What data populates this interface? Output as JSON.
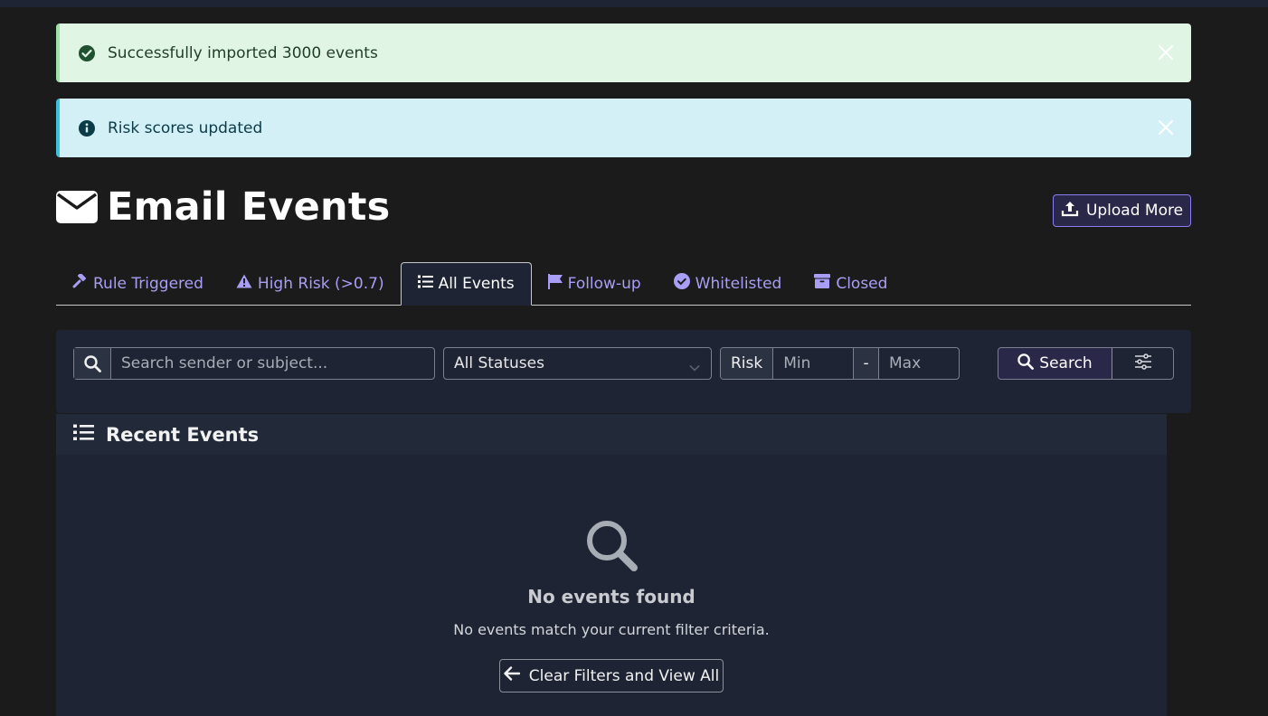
{
  "alerts": {
    "success": {
      "message": "Successfully imported 3000 events",
      "icon": "check-circle-icon"
    },
    "info": {
      "message": "Risk scores updated",
      "icon": "info-circle-icon"
    }
  },
  "header": {
    "title": "Email Events",
    "icon": "envelope-icon",
    "upload_label": "Upload More"
  },
  "tabs": [
    {
      "label": "Rule Triggered",
      "icon": "gavel-icon"
    },
    {
      "label": "High Risk (>0.7)",
      "icon": "warning-icon"
    },
    {
      "label": "All Events",
      "icon": "list-icon",
      "active": true
    },
    {
      "label": "Follow-up",
      "icon": "flag-icon"
    },
    {
      "label": "Whitelisted",
      "icon": "check-circle-icon"
    },
    {
      "label": "Closed",
      "icon": "archive-icon"
    }
  ],
  "filters": {
    "search_placeholder": "Search sender or subject...",
    "status_selected": "All Statuses",
    "risk_label": "Risk",
    "min_placeholder": "Min",
    "range_separator": "-",
    "max_placeholder": "Max",
    "search_button": "Search"
  },
  "events": {
    "header": "Recent Events",
    "empty_title": "No events found",
    "empty_message": "No events match your current filter criteria.",
    "clear_button": "Clear Filters and View All"
  },
  "colors": {
    "accent": "#a89ef5",
    "background": "#1b1b1b",
    "panel": "#1e2433"
  }
}
